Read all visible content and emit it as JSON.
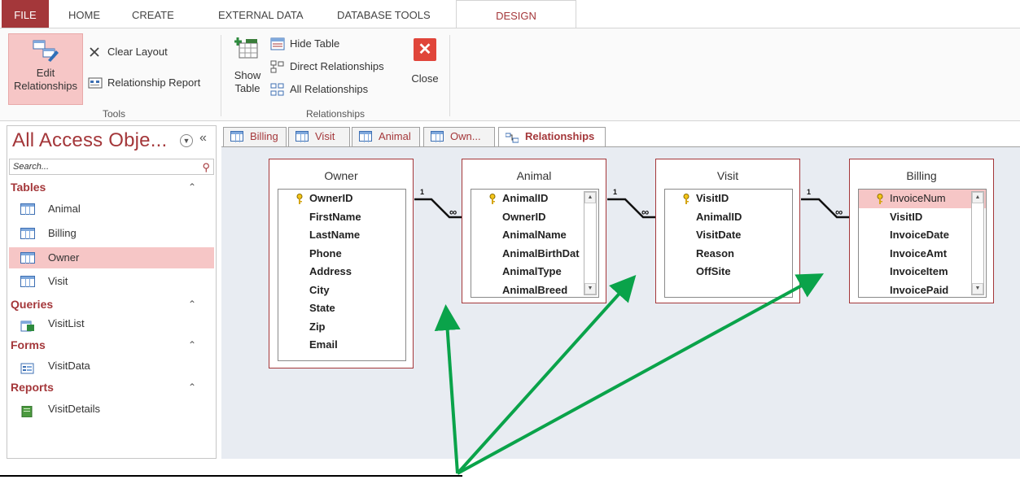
{
  "ribbon_tabs": [
    "FILE",
    "HOME",
    "CREATE",
    "EXTERNAL DATA",
    "DATABASE TOOLS",
    "DESIGN"
  ],
  "tools_group": {
    "label": "Tools",
    "edit_relationships": "Edit Relationships",
    "clear_layout": "Clear Layout",
    "relationship_report": "Relationship Report"
  },
  "relationships_group": {
    "label": "Relationships",
    "show_table": "Show Table",
    "hide_table": "Hide Table",
    "direct_relationships": "Direct Relationships",
    "all_relationships": "All Relationships",
    "close": "Close"
  },
  "nav": {
    "title": "All Access Obje...",
    "search_placeholder": "Search...",
    "sections": [
      {
        "header": "Tables",
        "items": [
          "Animal",
          "Billing",
          "Owner",
          "Visit"
        ]
      },
      {
        "header": "Queries",
        "items": [
          "VisitList"
        ]
      },
      {
        "header": "Forms",
        "items": [
          "VisitData"
        ]
      },
      {
        "header": "Reports",
        "items": [
          "VisitDetails"
        ]
      }
    ],
    "selected_item": "Owner"
  },
  "doc_tabs": [
    "Billing",
    "Visit",
    "Animal",
    "Own...",
    "Relationships"
  ],
  "active_doc_tab": "Relationships",
  "tables": [
    {
      "name": "Owner",
      "fields": [
        "OwnerID",
        "FirstName",
        "LastName",
        "Phone",
        "Address",
        "City",
        "State",
        "Zip",
        "Email"
      ],
      "key": "OwnerID"
    },
    {
      "name": "Animal",
      "fields": [
        "AnimalID",
        "OwnerID",
        "AnimalName",
        "AnimalBirthDat",
        "AnimalType",
        "AnimalBreed"
      ],
      "key": "AnimalID"
    },
    {
      "name": "Visit",
      "fields": [
        "VisitID",
        "AnimalID",
        "VisitDate",
        "Reason",
        "OffSite"
      ],
      "key": "VisitID"
    },
    {
      "name": "Billing",
      "fields": [
        "InvoiceNum",
        "VisitID",
        "InvoiceDate",
        "InvoiceAmt",
        "InvoiceItem",
        "InvoicePaid"
      ],
      "key": "InvoiceNum"
    }
  ],
  "relationship_labels": {
    "one": "1",
    "many": "∞"
  },
  "colors": {
    "accent": "#a4373a",
    "arrow": "#0aa34a",
    "selection": "#f6c6c6",
    "canvas": "#e8ecf2"
  }
}
